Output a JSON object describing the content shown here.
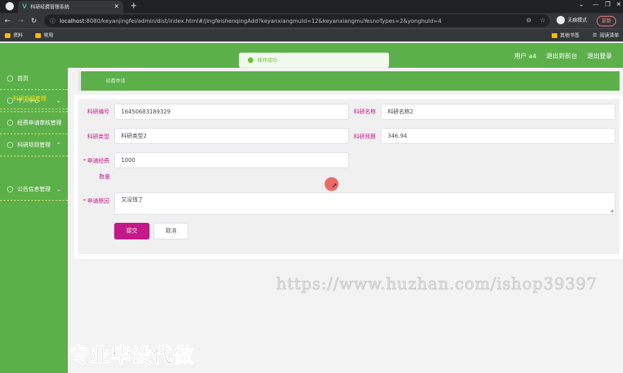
{
  "browser": {
    "tab_title": "科研经费管理系统",
    "url_host": "localhost",
    "url_rest": ":8080/keyanjingfei/admin/dist/index.html#/jingfeishenqingAdd?keyanxiangmuId=12&keyanxiangmuYesnoTypes=2&yonghuId=4",
    "incognito_label": "无痕模式",
    "update_label": "更新",
    "bookmarks": [
      "资料",
      "常用"
    ],
    "bookmarks_right": [
      "其他书签",
      "阅读清单"
    ]
  },
  "header": {
    "user_label": "用户 a4",
    "back_label": "退出到前台",
    "logout_label": "退出登录"
  },
  "toast": {
    "message": "操作成功"
  },
  "sidebar": {
    "items": [
      {
        "label": "首页"
      },
      {
        "label": "个人中心"
      },
      {
        "label": "经费申请审核管理"
      },
      {
        "label": "科研项目管理"
      },
      {
        "label": "公告信息管理"
      }
    ],
    "active_sub": "科研项目管理"
  },
  "breadcrumb": "经费申请",
  "form": {
    "code_label": "科研编号",
    "code_value": "16450683189329",
    "name_label": "科研名称",
    "name_value": "科研名称2",
    "type_label": "科研类型",
    "type_value": "科研类型2",
    "budget_label": "科研预算",
    "budget_value": "346.94",
    "amount_label_1": "申请经费",
    "amount_label_2": "数量",
    "amount_value": "1000",
    "reason_label": "申请原因",
    "reason_value": "又没钱了",
    "submit_label": "提交",
    "cancel_label": "取消"
  },
  "watermark": {
    "url": "https://www.huzhan.com/ishop39397",
    "text": "专业毕设代做"
  },
  "colors": {
    "primary_green": "#5cb04a",
    "accent_magenta": "#c21a86",
    "submenu_active": "#f5e50a",
    "toast_green": "#67c23a"
  }
}
